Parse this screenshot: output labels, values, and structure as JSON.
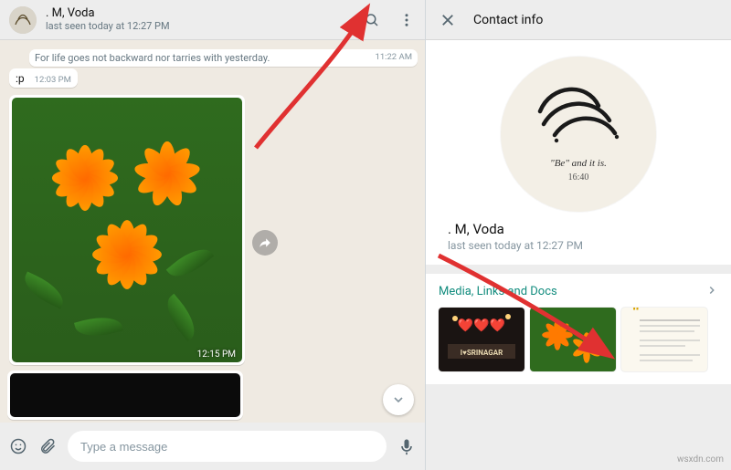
{
  "chat": {
    "contact_name": ". M, Voda",
    "contact_status": "last seen today at 12:27 PM",
    "messages": {
      "quote_text": "For life goes not backward nor tarries with yesterday.",
      "quote_time": "11:22 AM",
      "short_text": ":p",
      "short_time": "12:03 PM",
      "photo_time": "12:15 PM"
    },
    "input_placeholder": "Type a message"
  },
  "info": {
    "panel_title": "Contact info",
    "profile_name": ". M, Voda",
    "profile_status": "last seen today at 12:27 PM",
    "profile_caption_line1": "\"Be\" and it is.",
    "profile_caption_line2": "16:40",
    "media_section_title": "Media, Links and Docs"
  },
  "watermark": "wsxdn.com",
  "icons": {
    "search": "search-icon",
    "menu": "menu-icon",
    "close": "close-icon",
    "forward": "forward-icon",
    "chevron_down": "chevron-down-icon",
    "chevron_right": "chevron-right-icon",
    "emoji": "emoji-icon",
    "attach": "attach-icon",
    "mic": "mic-icon"
  }
}
